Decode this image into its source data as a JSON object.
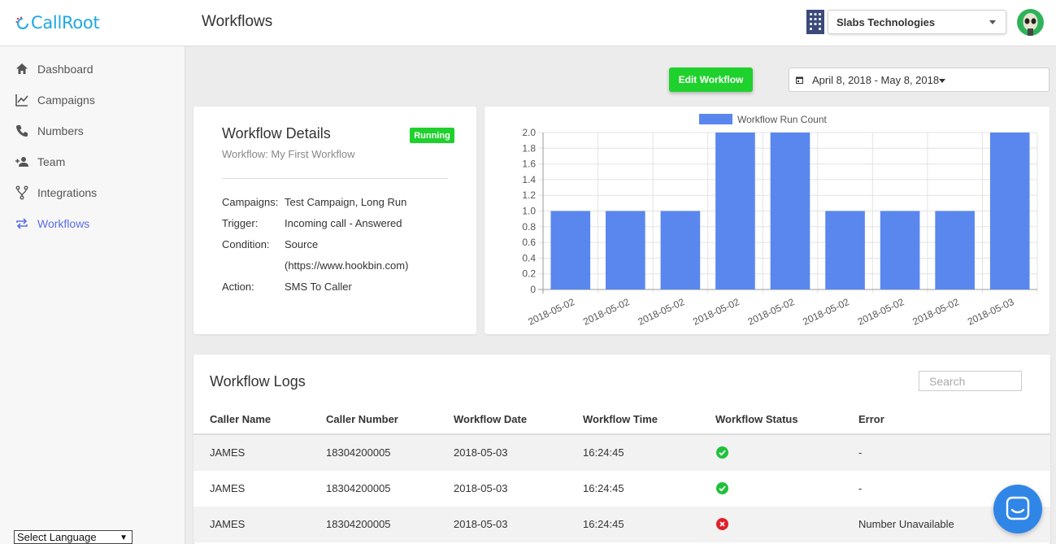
{
  "app": {
    "logo_text": "CallRoot",
    "page_title": "Workflows"
  },
  "header": {
    "company": "Slabs Technologies"
  },
  "sidebar": {
    "items": [
      {
        "label": "Dashboard",
        "icon": "home-icon"
      },
      {
        "label": "Campaigns",
        "icon": "line-chart-icon"
      },
      {
        "label": "Numbers",
        "icon": "phone-icon"
      },
      {
        "label": "Team",
        "icon": "add-user-icon"
      },
      {
        "label": "Integrations",
        "icon": "fork-icon"
      },
      {
        "label": "Workflows",
        "icon": "repeat-arrows-icon",
        "active": true
      }
    ],
    "language": "Select Language"
  },
  "toolbar": {
    "edit_label": "Edit Workflow",
    "date_range": "April 8, 2018 - May 8, 2018"
  },
  "details": {
    "title": "Workflow Details",
    "subtitle": "Workflow: My First Workflow",
    "status": "Running",
    "rows": [
      {
        "key": "Campaigns:",
        "value": "Test Campaign, Long Run"
      },
      {
        "key": "Trigger:",
        "value": "Incoming call - Answered"
      },
      {
        "key": "Condition:",
        "value": "Source"
      },
      {
        "key": "",
        "value": "(https://www.hookbin.com)"
      },
      {
        "key": "Action:",
        "value": "SMS To Caller"
      }
    ]
  },
  "chart_data": {
    "type": "bar",
    "categories": [
      "2018-05-02",
      "2018-05-02",
      "2018-05-02",
      "2018-05-02",
      "2018-05-02",
      "2018-05-02",
      "2018-05-02",
      "2018-05-02",
      "2018-05-03"
    ],
    "series": [
      {
        "name": "Workflow Run Count",
        "values": [
          1,
          1,
          1,
          2,
          2,
          1,
          1,
          1,
          2
        ]
      }
    ],
    "yticks": [
      "0",
      "0.2",
      "0.4",
      "0.6",
      "0.8",
      "1.0",
      "1.2",
      "1.4",
      "1.6",
      "1.8",
      "2.0"
    ],
    "ylim": [
      0,
      2
    ],
    "grid": true,
    "legend": "top-center",
    "color": "#5a87ee"
  },
  "logs": {
    "title": "Workflow Logs",
    "search_placeholder": "Search",
    "columns": [
      "Caller Name",
      "Caller Number",
      "Workflow Date",
      "Workflow Time",
      "Workflow Status",
      "Error"
    ],
    "rows": [
      {
        "name": "JAMES",
        "number": "18304200005",
        "date": "2018-05-03",
        "time": "16:24:45",
        "status": "success",
        "error": "-"
      },
      {
        "name": "JAMES",
        "number": "18304200005",
        "date": "2018-05-03",
        "time": "16:24:45",
        "status": "success",
        "error": "-"
      },
      {
        "name": "JAMES",
        "number": "18304200005",
        "date": "2018-05-03",
        "time": "16:24:45",
        "status": "failed",
        "error": "Number Unavailable"
      }
    ]
  }
}
